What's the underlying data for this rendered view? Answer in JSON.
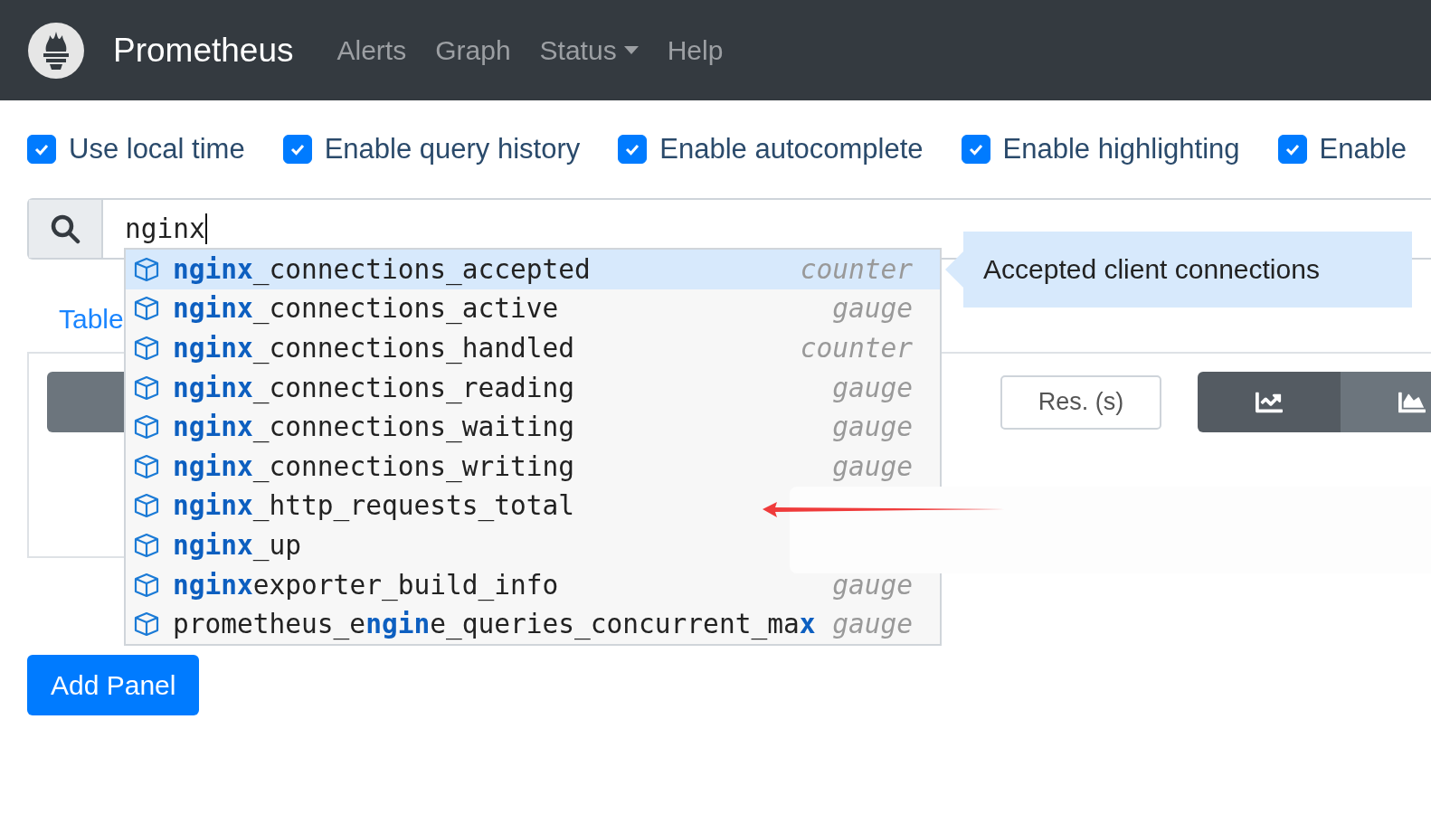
{
  "navbar": {
    "brand": "Prometheus",
    "links": [
      {
        "label": "Alerts",
        "dropdown": false
      },
      {
        "label": "Graph",
        "dropdown": false
      },
      {
        "label": "Status",
        "dropdown": true
      },
      {
        "label": "Help",
        "dropdown": false
      }
    ]
  },
  "options": [
    {
      "label": "Use local time",
      "checked": true
    },
    {
      "label": "Enable query history",
      "checked": true
    },
    {
      "label": "Enable autocomplete",
      "checked": true
    },
    {
      "label": "Enable highlighting",
      "checked": true
    },
    {
      "label": "Enable",
      "checked": true
    }
  ],
  "query": {
    "value": "nginx"
  },
  "autocomplete": {
    "items": [
      {
        "label": "**nginx**_connections_accepted",
        "type": "counter",
        "selected": true
      },
      {
        "label": "**nginx**_connections_active",
        "type": "gauge",
        "selected": false
      },
      {
        "label": "**nginx**_connections_handled",
        "type": "counter",
        "selected": false
      },
      {
        "label": "**nginx**_connections_reading",
        "type": "gauge",
        "selected": false
      },
      {
        "label": "**nginx**_connections_waiting",
        "type": "gauge",
        "selected": false
      },
      {
        "label": "**nginx**_connections_writing",
        "type": "gauge",
        "selected": false
      },
      {
        "label": "**nginx**_http_requests_total",
        "selected": false
      },
      {
        "label": "**nginx**_up",
        "selected": false
      },
      {
        "label": "**nginx**exporter_build_info",
        "type": "gauge",
        "selected": false
      },
      {
        "label": "prometheus_e**ngin**e_queries_concurrent_ma**x**",
        "type": "gauge",
        "selected": false
      }
    ],
    "tooltip": "Accepted client connections"
  },
  "tabs": [
    {
      "label": "Table"
    }
  ],
  "panel": {
    "resolution": {
      "placeholder": "Res. (s)"
    },
    "chart_modes": [
      {
        "kind": "line",
        "selected": true
      },
      {
        "kind": "stacked",
        "selected": false
      }
    ]
  },
  "add_panel_button": "Add Panel"
}
